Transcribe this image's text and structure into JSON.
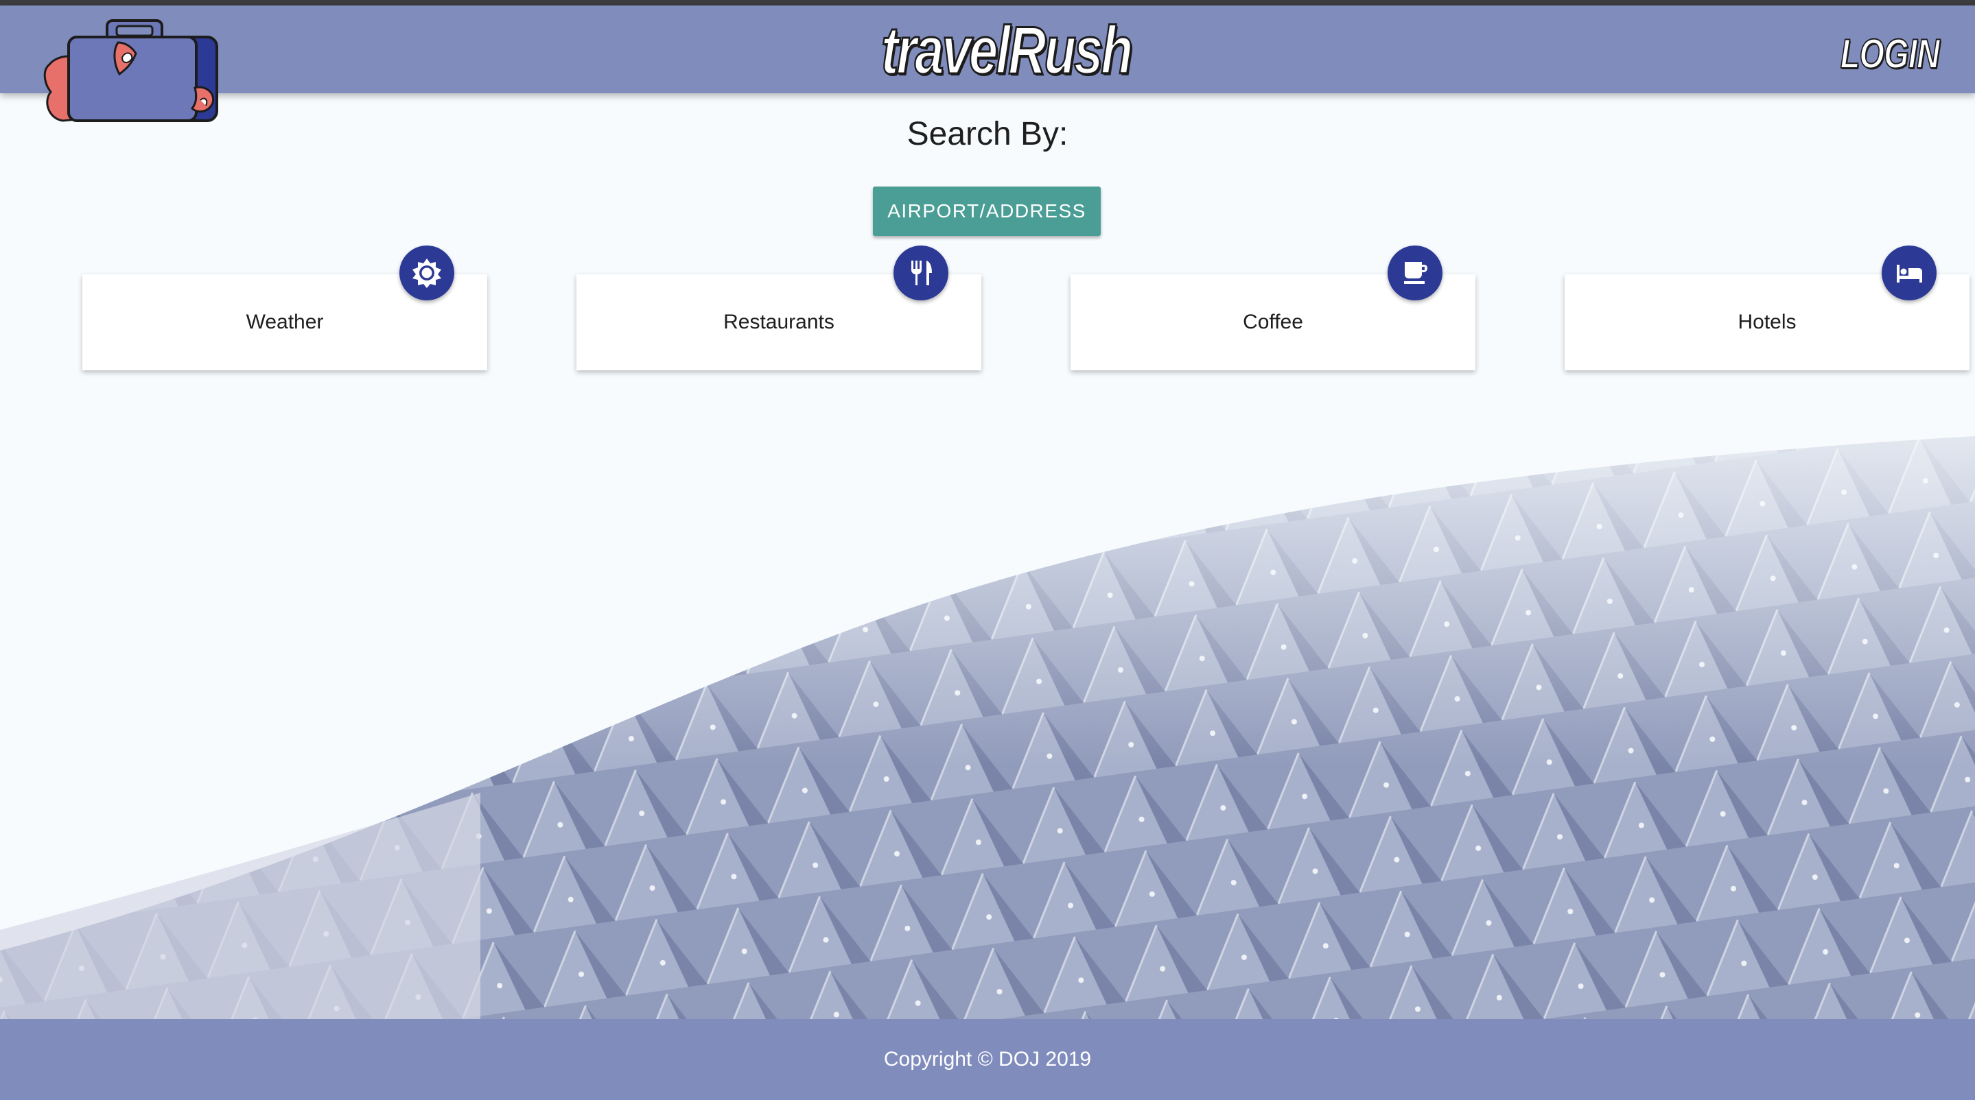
{
  "header": {
    "brand": "travelRush",
    "login_label": "LOGIN",
    "logo_icon": "suitcase-logo-icon"
  },
  "main": {
    "search_heading": "Search By:",
    "search_button_label": "AIRPORT/ADDRESS",
    "cards": [
      {
        "label": "Weather",
        "icon": "sun-icon"
      },
      {
        "label": "Restaurants",
        "icon": "utensils-icon"
      },
      {
        "label": "Coffee",
        "icon": "coffee-cup-icon"
      },
      {
        "label": "Hotels",
        "icon": "bed-icon"
      }
    ]
  },
  "footer": {
    "copyright": "Copyright © DOJ 2019"
  },
  "colors": {
    "navbar": "#808cbc",
    "accent_button": "#4a9e95",
    "fab": "#2c3a96",
    "background": "#f7fbfd"
  }
}
